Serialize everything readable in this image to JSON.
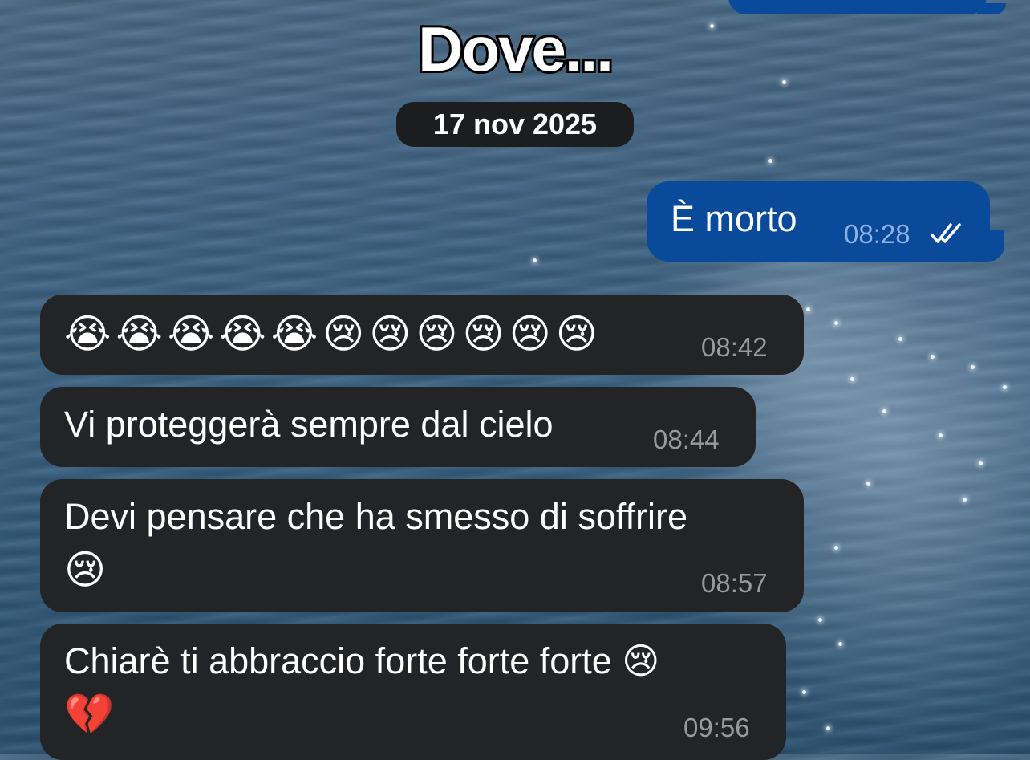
{
  "chat": {
    "title": "Dove...",
    "date_separator": "17 nov 2025"
  },
  "messages": [
    {
      "direction": "outgoing",
      "text": "È morto",
      "time": "08:28",
      "status": "read-double-check"
    },
    {
      "direction": "incoming",
      "text": "😭😭😭😭😭😢😢😢😢😢😢",
      "time": "08:42"
    },
    {
      "direction": "incoming",
      "text": "Vi proteggerà sempre dal cielo",
      "time": "08:44"
    },
    {
      "direction": "incoming",
      "text_line1": "Devi pensare che ha smesso di soffrire",
      "text_line2": "😢",
      "time": "08:57"
    },
    {
      "direction": "incoming",
      "text_line1": "Chiarè ti abbraccio forte forte forte 😢",
      "text_line2": "💔",
      "time": "09:56"
    }
  ],
  "colors": {
    "outgoing_bubble": "#0a4a9a",
    "incoming_bubble": "#232425",
    "timestamp_incoming": "#9a9a9a",
    "timestamp_outgoing": "#8db1e0"
  }
}
